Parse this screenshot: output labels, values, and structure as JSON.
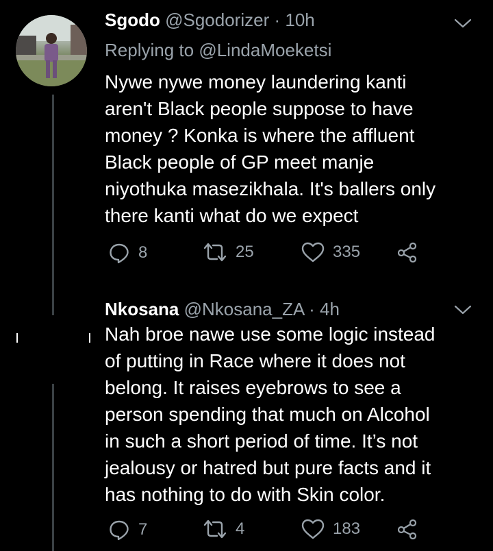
{
  "tweets": [
    {
      "name": "Sgodo",
      "handle": "@Sgodorizer",
      "separator": "·",
      "time": "10h",
      "replying_prefix": "Replying to",
      "replying_handle": "@LindaMoeketsi",
      "lines": [
        "Nywe nywe money laundering kanti",
        "aren't Black people suppose to have",
        "money ? Konka is where the affluent",
        "Black people of GP meet manje",
        "niyothuka masezikhala. It's ballers only",
        "there kanti what do we expect"
      ],
      "replies": "8",
      "retweets": "25",
      "likes": "335"
    },
    {
      "name": "Nkosana",
      "handle": "@Nkosana_ZA",
      "separator": "·",
      "time": "4h",
      "lines": [
        "Nah broe nawe use some logic instead",
        "of putting in Race where it does not",
        "belong. It raises eyebrows to see a",
        "person spending that much on Alcohol",
        "in such a short period of time. It’s not",
        "jealousy or hatred but pure facts and it",
        "has nothing to do with Skin color."
      ],
      "replies": "7",
      "retweets": "4",
      "likes": "183"
    }
  ],
  "icons": {
    "reply": "reply-icon",
    "retweet": "retweet-icon",
    "like": "heart-icon",
    "share": "share-icon",
    "more": "chevron-down-icon"
  },
  "colors": {
    "background": "#000000",
    "text": "#ffffff",
    "secondary": "#9aa3ab"
  }
}
